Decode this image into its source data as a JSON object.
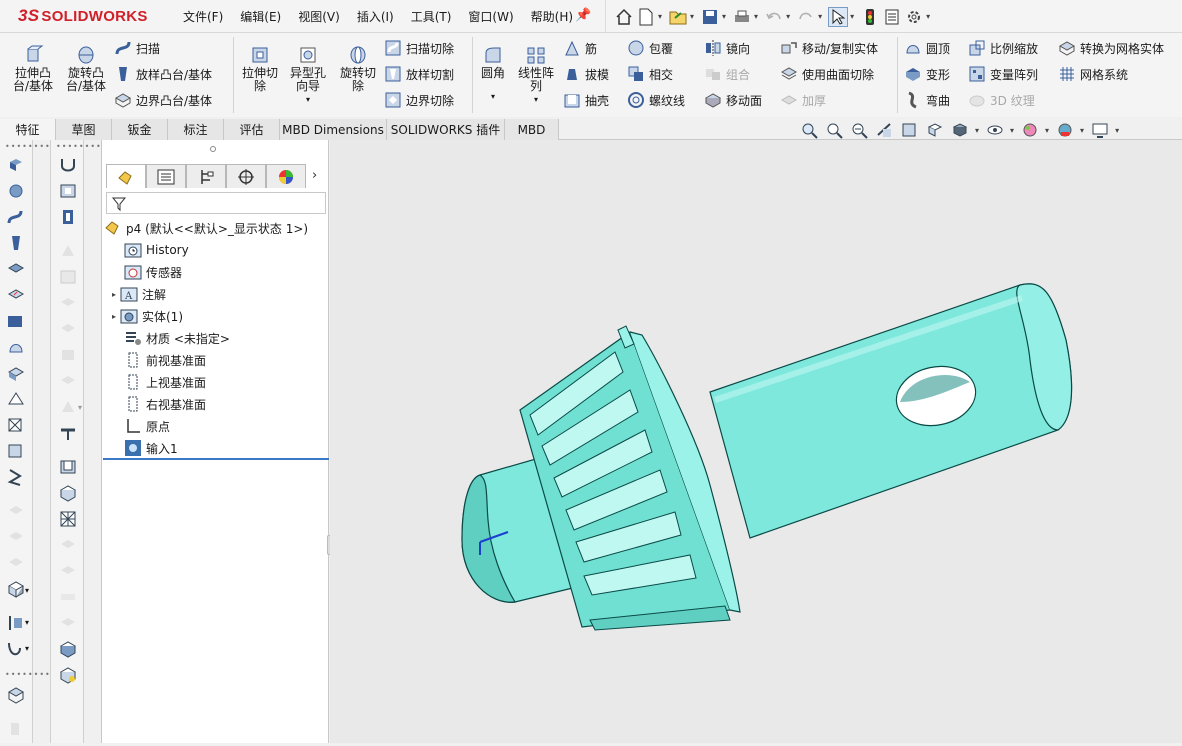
{
  "app": {
    "logo_text": "SOLIDWORKS",
    "logo_prefix": "3S"
  },
  "menu": {
    "items": [
      "文件(F)",
      "编辑(E)",
      "视图(V)",
      "插入(I)",
      "工具(T)",
      "窗口(W)",
      "帮助(H)"
    ]
  },
  "ribbon": {
    "extrude_boss": "拉伸凸台/基体",
    "revolve_boss": "旋转凸台/基体",
    "sweep": "扫描",
    "loft_boss": "放样凸台/基体",
    "boundary_boss": "边界凸台/基体",
    "extrude_cut": "拉伸切除",
    "hole_wizard": "异型孔向导",
    "revolve_cut": "旋转切除",
    "swept_cut": "扫描切除",
    "lofted_cut": "放样切割",
    "boundary_cut": "边界切除",
    "fillet": "圆角",
    "linear_pattern": "线性阵列",
    "rib": "筋",
    "draft": "拔模",
    "shell": "抽壳",
    "wrap": "包覆",
    "intersect": "相交",
    "helix": "螺纹线",
    "mirror": "镜向",
    "combine": "组合",
    "move_face": "移动面",
    "move_copy_body": "移动/复制实体",
    "cut_with_surface": "使用曲面切除",
    "thicken": "加厚",
    "dome": "圆顶",
    "deform": "变形",
    "flex": "弯曲",
    "scale": "比例缩放",
    "variable_pattern": "变量阵列",
    "texture_3d": "3D 纹理",
    "convert_mesh": "转换为网格实体",
    "mesh_system": "网格系统"
  },
  "tabs": [
    "特征",
    "草图",
    "钣金",
    "标注",
    "评估",
    "MBD Dimensions",
    "SOLIDWORKS 插件",
    "MBD"
  ],
  "tree": {
    "root": "p4  (默认<<默认>_显示状态 1>)",
    "items": [
      "History",
      "传感器",
      "注解",
      "实体(1)",
      "材质 <未指定>",
      "前视基准面",
      "上视基准面",
      "右视基准面",
      "原点",
      "输入1"
    ]
  },
  "colors": {
    "part": "#7fe8dc",
    "accent": "#3b78c8"
  }
}
